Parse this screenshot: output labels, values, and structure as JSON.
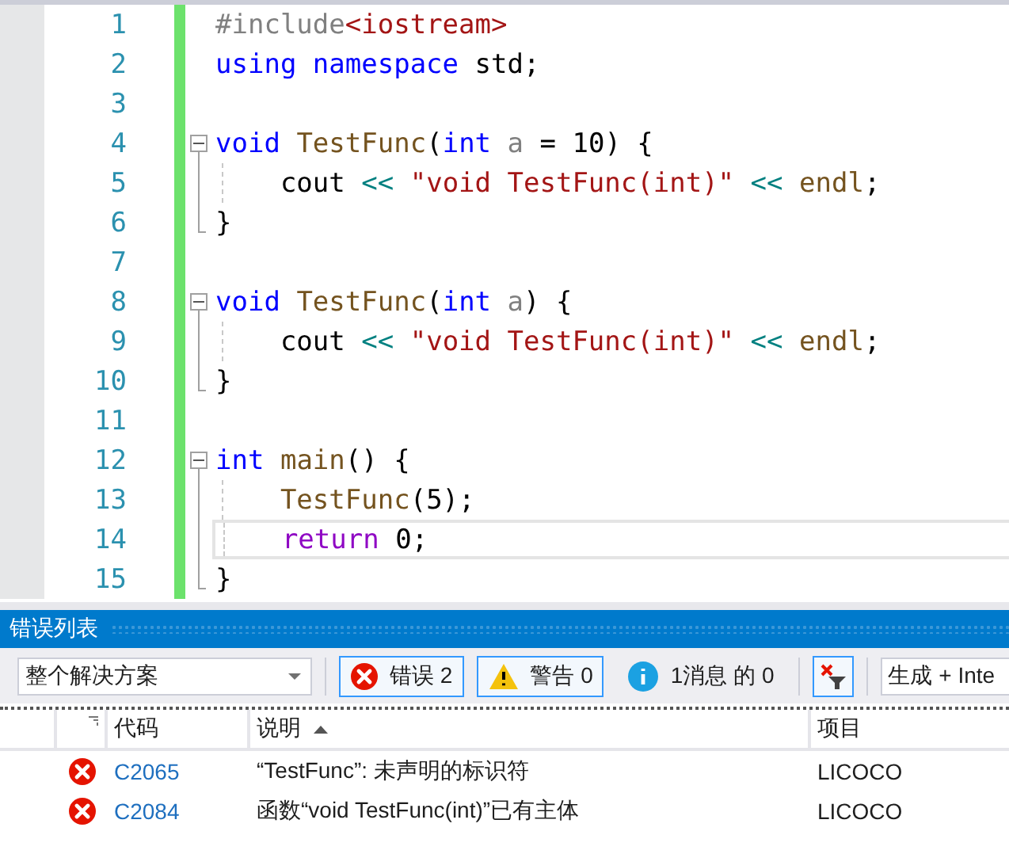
{
  "editor": {
    "lines": [
      {
        "number": "1",
        "kind": "plain",
        "indented": false,
        "current": false,
        "tokens": [
          {
            "t": "#include",
            "kind": "preproc"
          },
          {
            "t": "<iostream>",
            "kind": "string"
          }
        ]
      },
      {
        "number": "2",
        "kind": "plain",
        "indented": false,
        "current": false,
        "tokens": [
          {
            "t": "using namespace ",
            "kind": "keyword"
          },
          {
            "t": "std;",
            "kind": "plain"
          }
        ]
      },
      {
        "number": "3",
        "kind": "plain",
        "current": false
      },
      {
        "number": "4",
        "kind": "fold_start",
        "indented": false,
        "current": false,
        "tokens": [
          {
            "t": "void ",
            "kind": "keyword"
          },
          {
            "t": "TestFunc",
            "kind": "function"
          },
          {
            "t": "(",
            "kind": "plain"
          },
          {
            "t": "int ",
            "kind": "keyword"
          },
          {
            "t": "a",
            "kind": "param"
          },
          {
            "t": " = 10) {",
            "kind": "plain"
          }
        ]
      },
      {
        "number": "5",
        "kind": "fold_inner",
        "indented": true,
        "current": false,
        "tokens": [
          {
            "t": "cout ",
            "kind": "plain"
          },
          {
            "t": "<< ",
            "kind": "operator"
          },
          {
            "t": "\"void TestFunc(int)\" ",
            "kind": "string"
          },
          {
            "t": "<< ",
            "kind": "operator"
          },
          {
            "t": "endl",
            "kind": "function"
          },
          {
            "t": ";",
            "kind": "plain"
          }
        ]
      },
      {
        "number": "6",
        "kind": "fold_end",
        "indented": false,
        "current": false,
        "tokens": [
          {
            "t": "}",
            "kind": "plain"
          }
        ]
      },
      {
        "number": "7",
        "kind": "plain",
        "current": false
      },
      {
        "number": "8",
        "kind": "fold_start",
        "indented": false,
        "current": false,
        "tokens": [
          {
            "t": "void ",
            "kind": "keyword"
          },
          {
            "t": "TestFunc",
            "kind": "function"
          },
          {
            "t": "(",
            "kind": "plain"
          },
          {
            "t": "int ",
            "kind": "keyword"
          },
          {
            "t": "a",
            "kind": "param"
          },
          {
            "t": ") {",
            "kind": "plain"
          }
        ]
      },
      {
        "number": "9",
        "kind": "fold_inner",
        "indented": true,
        "current": false,
        "tokens": [
          {
            "t": "cout ",
            "kind": "plain"
          },
          {
            "t": "<< ",
            "kind": "operator"
          },
          {
            "t": "\"void TestFunc(int)\" ",
            "kind": "string"
          },
          {
            "t": "<< ",
            "kind": "operator"
          },
          {
            "t": "endl",
            "kind": "function"
          },
          {
            "t": ";",
            "kind": "plain"
          }
        ]
      },
      {
        "number": "10",
        "kind": "fold_end",
        "indented": false,
        "current": false,
        "tokens": [
          {
            "t": "}",
            "kind": "plain"
          }
        ]
      },
      {
        "number": "11",
        "kind": "plain",
        "current": false
      },
      {
        "number": "12",
        "kind": "fold_start",
        "indented": false,
        "current": false,
        "tokens": [
          {
            "t": "int ",
            "kind": "keyword"
          },
          {
            "t": "main",
            "kind": "function"
          },
          {
            "t": "() {",
            "kind": "plain"
          }
        ]
      },
      {
        "number": "13",
        "kind": "fold_inner",
        "indented": true,
        "current": false,
        "tokens": [
          {
            "t": "TestFunc",
            "kind": "function"
          },
          {
            "t": "(5);",
            "kind": "plain"
          }
        ]
      },
      {
        "number": "14",
        "kind": "fold_inner",
        "indented": true,
        "current": true,
        "tokens": [
          {
            "t": "return ",
            "kind": "control"
          },
          {
            "t": "0;",
            "kind": "plain"
          }
        ]
      },
      {
        "number": "15",
        "kind": "fold_end",
        "indented": false,
        "current": false,
        "tokens": [
          {
            "t": "}",
            "kind": "plain"
          }
        ]
      }
    ]
  },
  "error_list": {
    "title": "错误列表",
    "scope": {
      "value": "整个解决方案"
    },
    "filters": [
      {
        "kind": "error",
        "label": "错误 2",
        "selected": true
      },
      {
        "kind": "warning",
        "label": "警告 0",
        "selected": true
      },
      {
        "kind": "info",
        "label": "1消息 的 0",
        "selected": false
      }
    ],
    "clear_filter": {
      "on": true
    },
    "source": {
      "value": "生成 + Inte"
    },
    "columns": [
      {
        "label": "代码"
      },
      {
        "label": "说明",
        "sorted": true
      },
      {
        "label": "项目"
      }
    ],
    "rows": [
      {
        "kind": "error",
        "code": "C2065",
        "description": "“TestFunc”: 未声明的标识符",
        "project": "LICOCO"
      },
      {
        "kind": "error",
        "code": "C2084",
        "description": "函数“void TestFunc(int)”已有主体",
        "project": "LICOCO"
      }
    ]
  }
}
